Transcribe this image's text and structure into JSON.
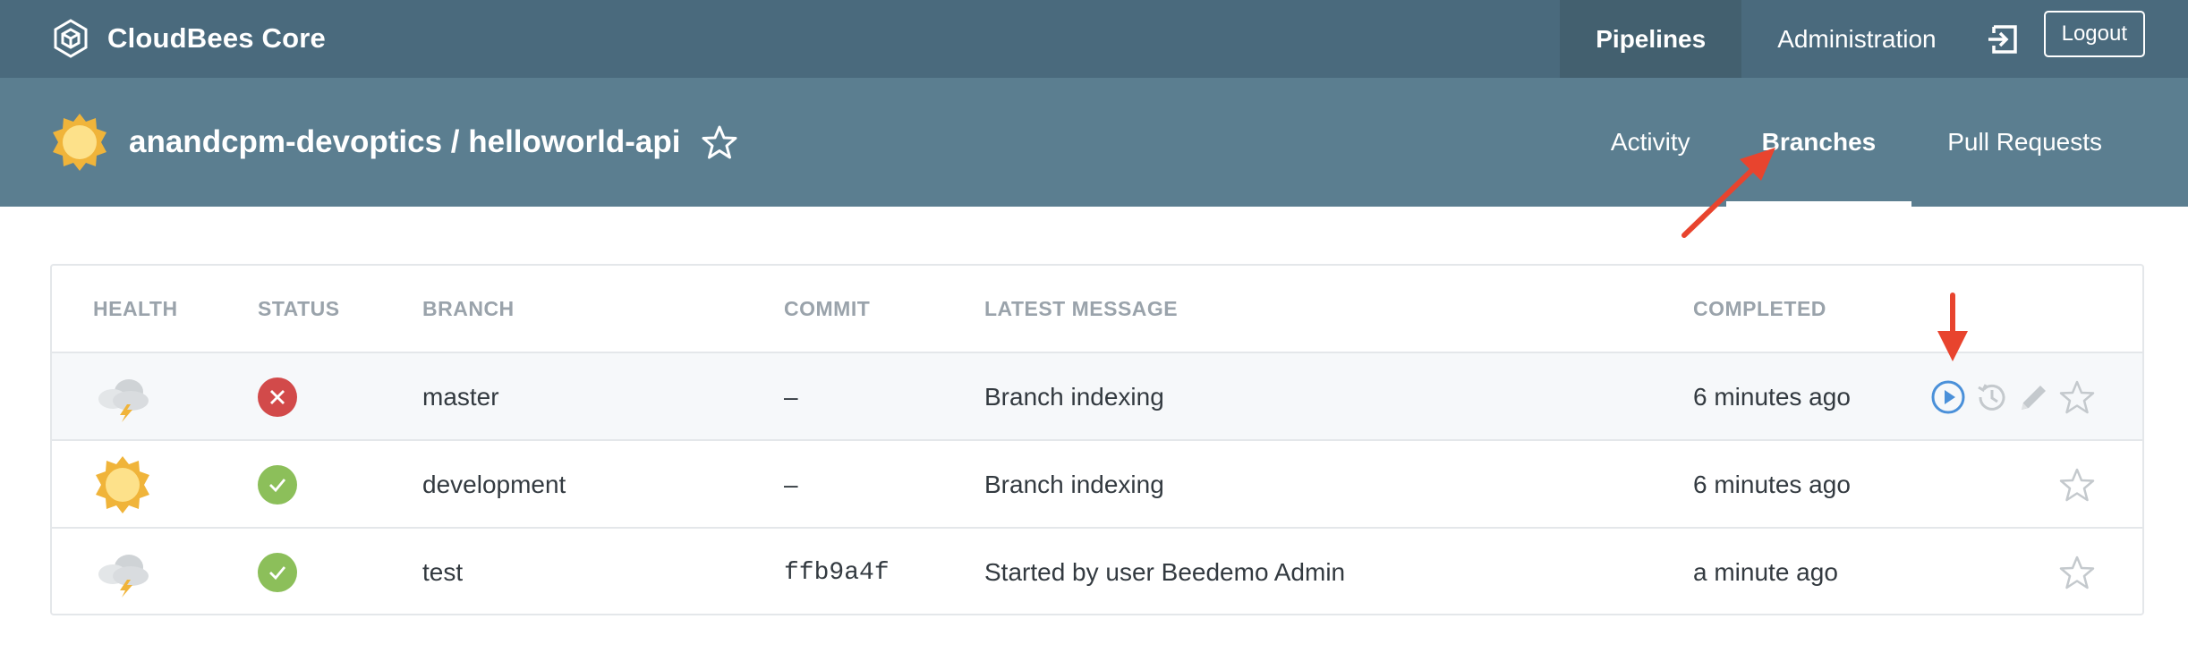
{
  "topbar": {
    "brand": "CloudBees Core",
    "nav": [
      {
        "label": "Pipelines",
        "active": true
      },
      {
        "label": "Administration",
        "active": false
      }
    ],
    "logout": "Logout"
  },
  "header": {
    "title": "anandcpm-devoptics / helloworld-api",
    "tabs": [
      {
        "label": "Activity",
        "active": false
      },
      {
        "label": "Branches",
        "active": true
      },
      {
        "label": "Pull Requests",
        "active": false
      }
    ]
  },
  "table": {
    "columns": [
      "HEALTH",
      "STATUS",
      "BRANCH",
      "COMMIT",
      "LATEST MESSAGE",
      "COMPLETED"
    ],
    "rows": [
      {
        "health": "stormy-weather-icon",
        "status": "failed",
        "branch": "master",
        "commit": "–",
        "message": "Branch indexing",
        "completed": "6 minutes ago",
        "actions": [
          "run-icon",
          "history-icon",
          "edit-icon",
          "star-icon"
        ]
      },
      {
        "health": "sunny-weather-icon",
        "status": "success",
        "branch": "development",
        "commit": "–",
        "message": "Branch indexing",
        "completed": "6 minutes ago",
        "actions": [
          "star-icon"
        ]
      },
      {
        "health": "stormy-weather-icon",
        "status": "success",
        "branch": "test",
        "commit": "ffb9a4f",
        "message": "Started by user Beedemo Admin",
        "completed": "a minute ago",
        "actions": [
          "star-icon"
        ]
      }
    ]
  },
  "colors": {
    "topbar": "#4a6a7d",
    "subbar": "#5b7e90",
    "fail": "#d24a4a",
    "success": "#8cbf5a",
    "run": "#4a90d9",
    "annotation_arrow": "#e8442e"
  }
}
